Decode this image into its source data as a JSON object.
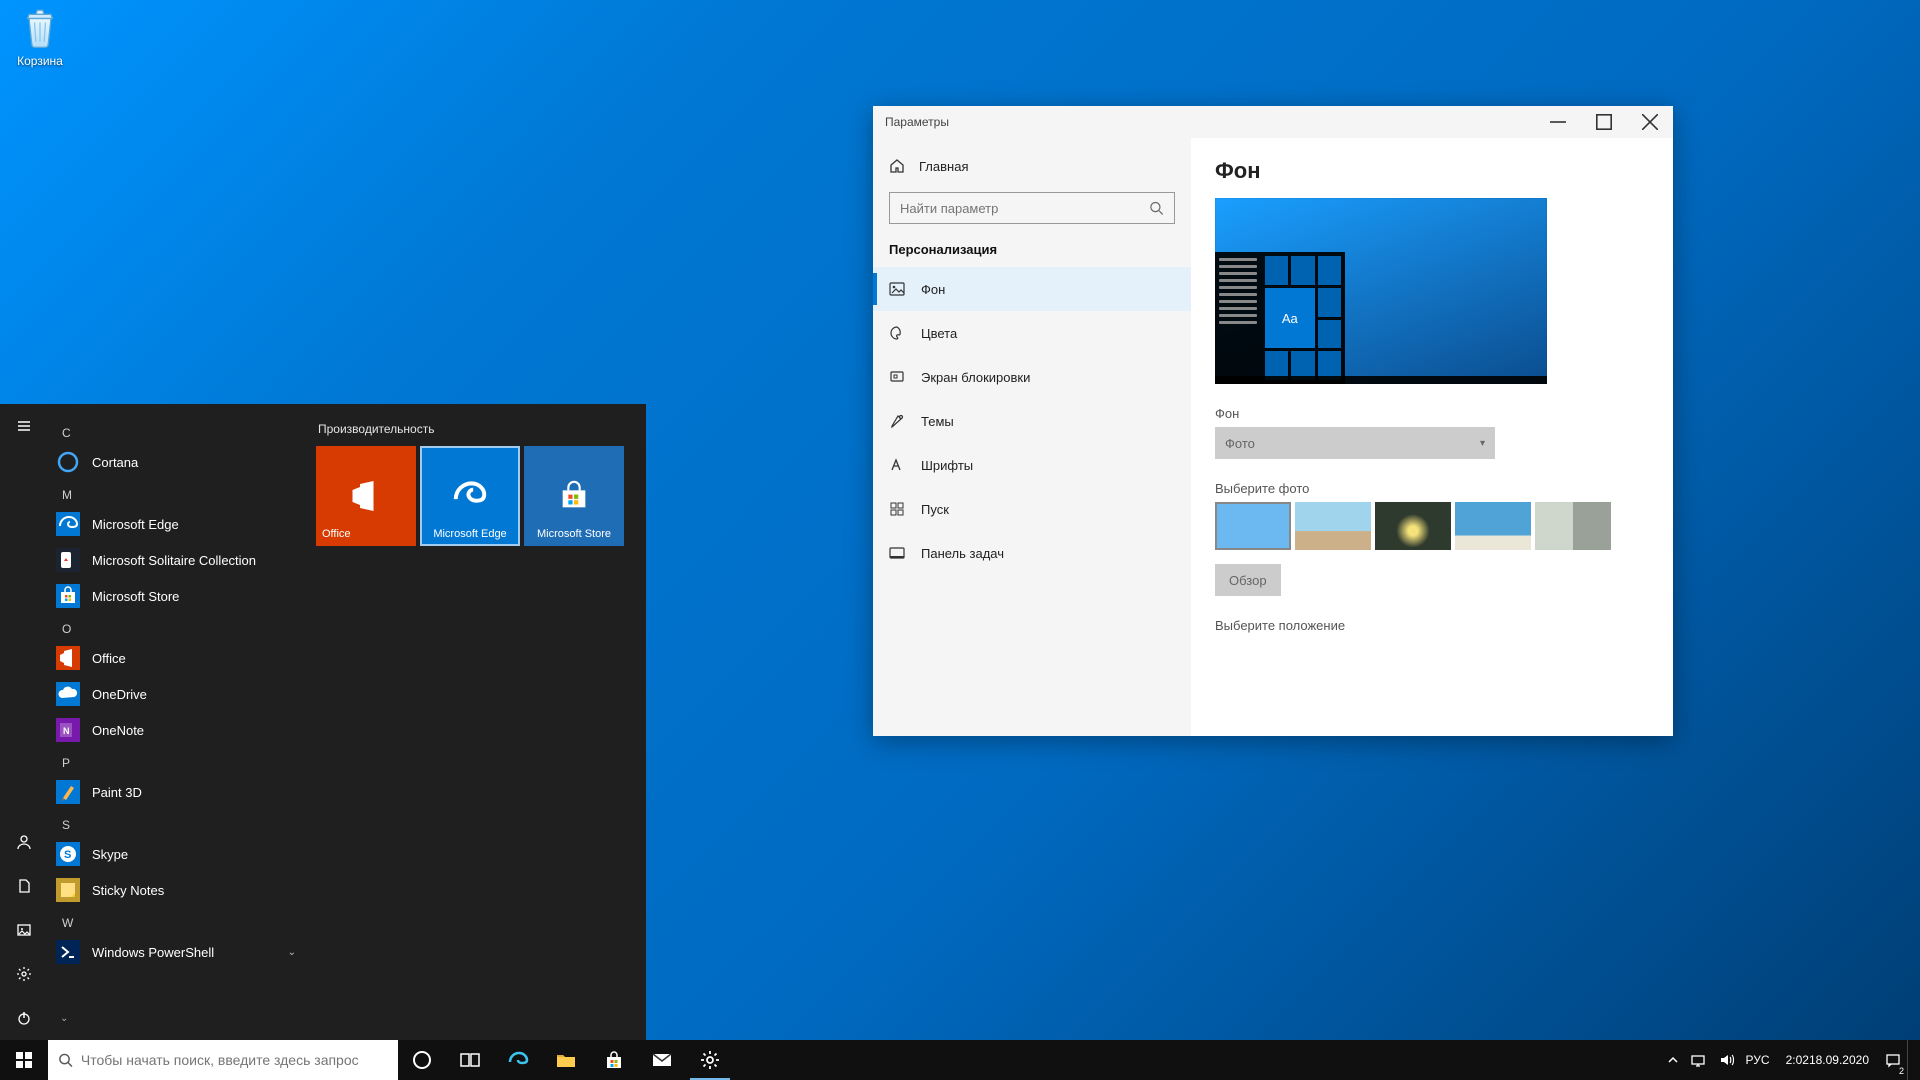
{
  "desktop": {
    "recycle_bin_label": "Корзина"
  },
  "taskbar": {
    "search_placeholder": "Чтобы начать поиск, введите здесь запрос",
    "tray": {
      "ime": "РУС",
      "time": "2:02",
      "date": "18.09.2020",
      "notifications": "2"
    }
  },
  "start_menu": {
    "tile_group_label": "Производительность",
    "tiles": [
      {
        "label": "Office",
        "bg": "#d83b01"
      },
      {
        "label": "Microsoft Edge",
        "bg": "#0078d4"
      },
      {
        "label": "Microsoft Store",
        "bg": "#1f6db5"
      }
    ],
    "sections": {
      "c": {
        "letter": "C",
        "apps": [
          "Cortana"
        ]
      },
      "m": {
        "letter": "M",
        "apps": [
          "Microsoft Edge",
          "Microsoft Solitaire Collection",
          "Microsoft Store"
        ]
      },
      "o": {
        "letter": "O",
        "apps": [
          "Office",
          "OneDrive",
          "OneNote"
        ]
      },
      "p": {
        "letter": "P",
        "apps": [
          "Paint 3D"
        ]
      },
      "s": {
        "letter": "S",
        "apps": [
          "Skype",
          "Sticky Notes"
        ]
      },
      "w": {
        "letter": "W",
        "apps": [
          "Windows PowerShell"
        ]
      }
    }
  },
  "settings": {
    "window_title": "Параметры",
    "nav": {
      "home": "Главная",
      "search_placeholder": "Найти параметр",
      "section_title": "Персонализация",
      "items": [
        "Фон",
        "Цвета",
        "Экран блокировки",
        "Темы",
        "Шрифты",
        "Пуск",
        "Панель задач"
      ],
      "active_index": 0
    },
    "content": {
      "heading": "Фон",
      "preview_tile_text": "Aa",
      "bg_label": "Фон",
      "bg_value": "Фото",
      "photo_label": "Выберите фото",
      "thumbs": [
        {
          "bg": "#6cb8f0"
        },
        {
          "bg": "#9fd0e8"
        },
        {
          "bg": "#2f3a2e"
        },
        {
          "bg": "#4fa3d6"
        },
        {
          "bg": "#cfd6cc"
        }
      ],
      "browse_label": "Обзор",
      "fit_label": "Выберите положение"
    }
  }
}
